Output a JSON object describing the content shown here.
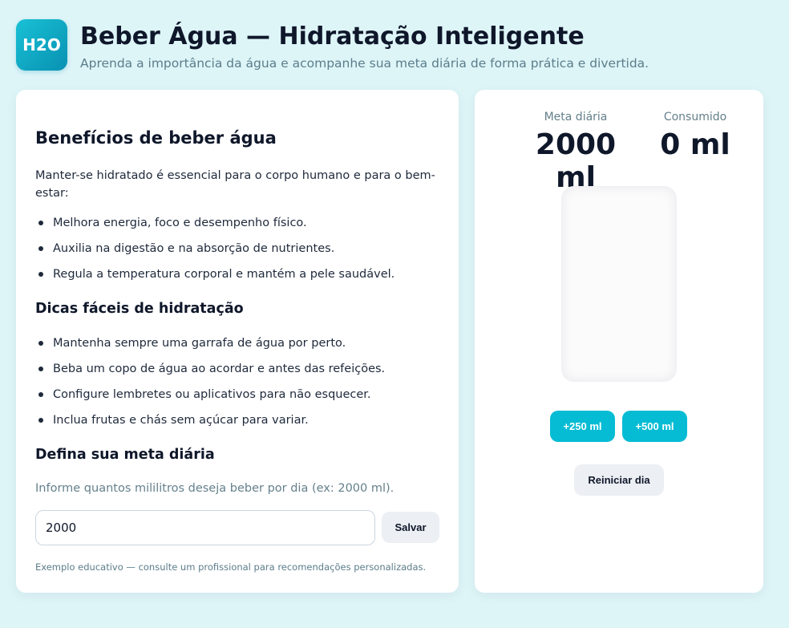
{
  "header": {
    "logo_text": "H2O",
    "title": "Beber Água — Hidratação Inteligente",
    "subtitle": "Aprenda a importância da água e acompanhe sua meta diária de forma prática e divertida."
  },
  "info": {
    "benefits_title": "Benefícios de beber água",
    "intro": "Manter-se hidratado é essencial para o corpo humano e para o bem-estar:",
    "benefits": [
      "Melhora energia, foco e desempenho físico.",
      "Auxilia na digestão e na absorção de nutrientes.",
      "Regula a temperatura corporal e mantém a pele saudável."
    ],
    "tips_title": "Dicas fáceis de hidratação",
    "tips": [
      "Mantenha sempre uma garrafa de água por perto.",
      "Beba um copo de água ao acordar e antes das refeições.",
      "Configure lembretes ou aplicativos para não esquecer.",
      "Inclua frutas e chás sem açúcar para variar."
    ],
    "goal_title": "Defina sua meta diária",
    "goal_hint": "Informe quantos mililitros deseja beber por dia (ex: 2000 ml).",
    "goal_value": "2000",
    "save_label": "Salvar",
    "footnote": "Exemplo educativo — consulte um profissional para recomendações personalizadas."
  },
  "tracker": {
    "goal_label": "Meta diária",
    "goal_display": "2000 ml",
    "consumed_label": "Consumido",
    "consumed_display": "0 ml",
    "fill_fraction": 0,
    "add_250_label": "+250 ml",
    "add_500_label": "+500 ml",
    "reset_label": "Reiniciar dia"
  },
  "colors": {
    "background": "#def5f8",
    "accent": "#06bcd4",
    "water": "#67d6e6"
  }
}
